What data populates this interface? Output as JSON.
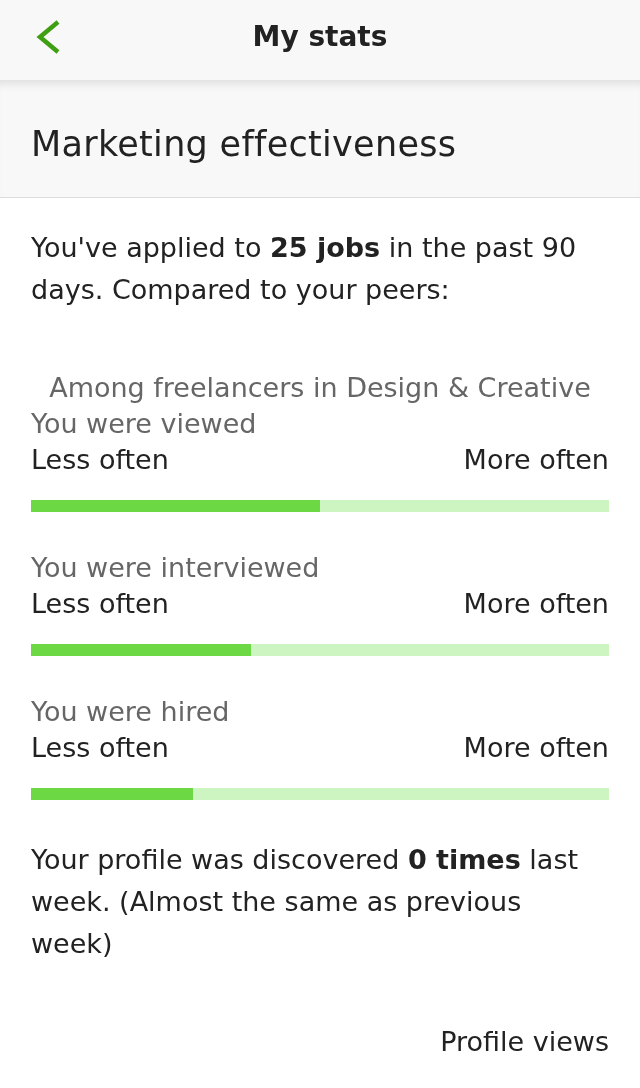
{
  "header": {
    "title": "My stats"
  },
  "section": {
    "title": "Marketing effectiveness"
  },
  "summary": "You've applied to **25 jobs** in the past 90 days. Compared to your peers:",
  "peer_group": "Among freelancers in Design & Creative",
  "metrics": [
    {
      "label": "You were viewed",
      "low_label": "Less often",
      "high_label": "More often",
      "level": 0.5
    },
    {
      "label": "You were interviewed",
      "low_label": "Less often",
      "high_label": "More often",
      "level": 0.38
    },
    {
      "label": "You were hired",
      "low_label": "Less often",
      "high_label": "More often",
      "level": 0.28
    }
  ],
  "discovery": "Your profile was discovered **0 times** last week. (Almost the same as previous week)",
  "next_section": {
    "title": "Profile views"
  }
}
